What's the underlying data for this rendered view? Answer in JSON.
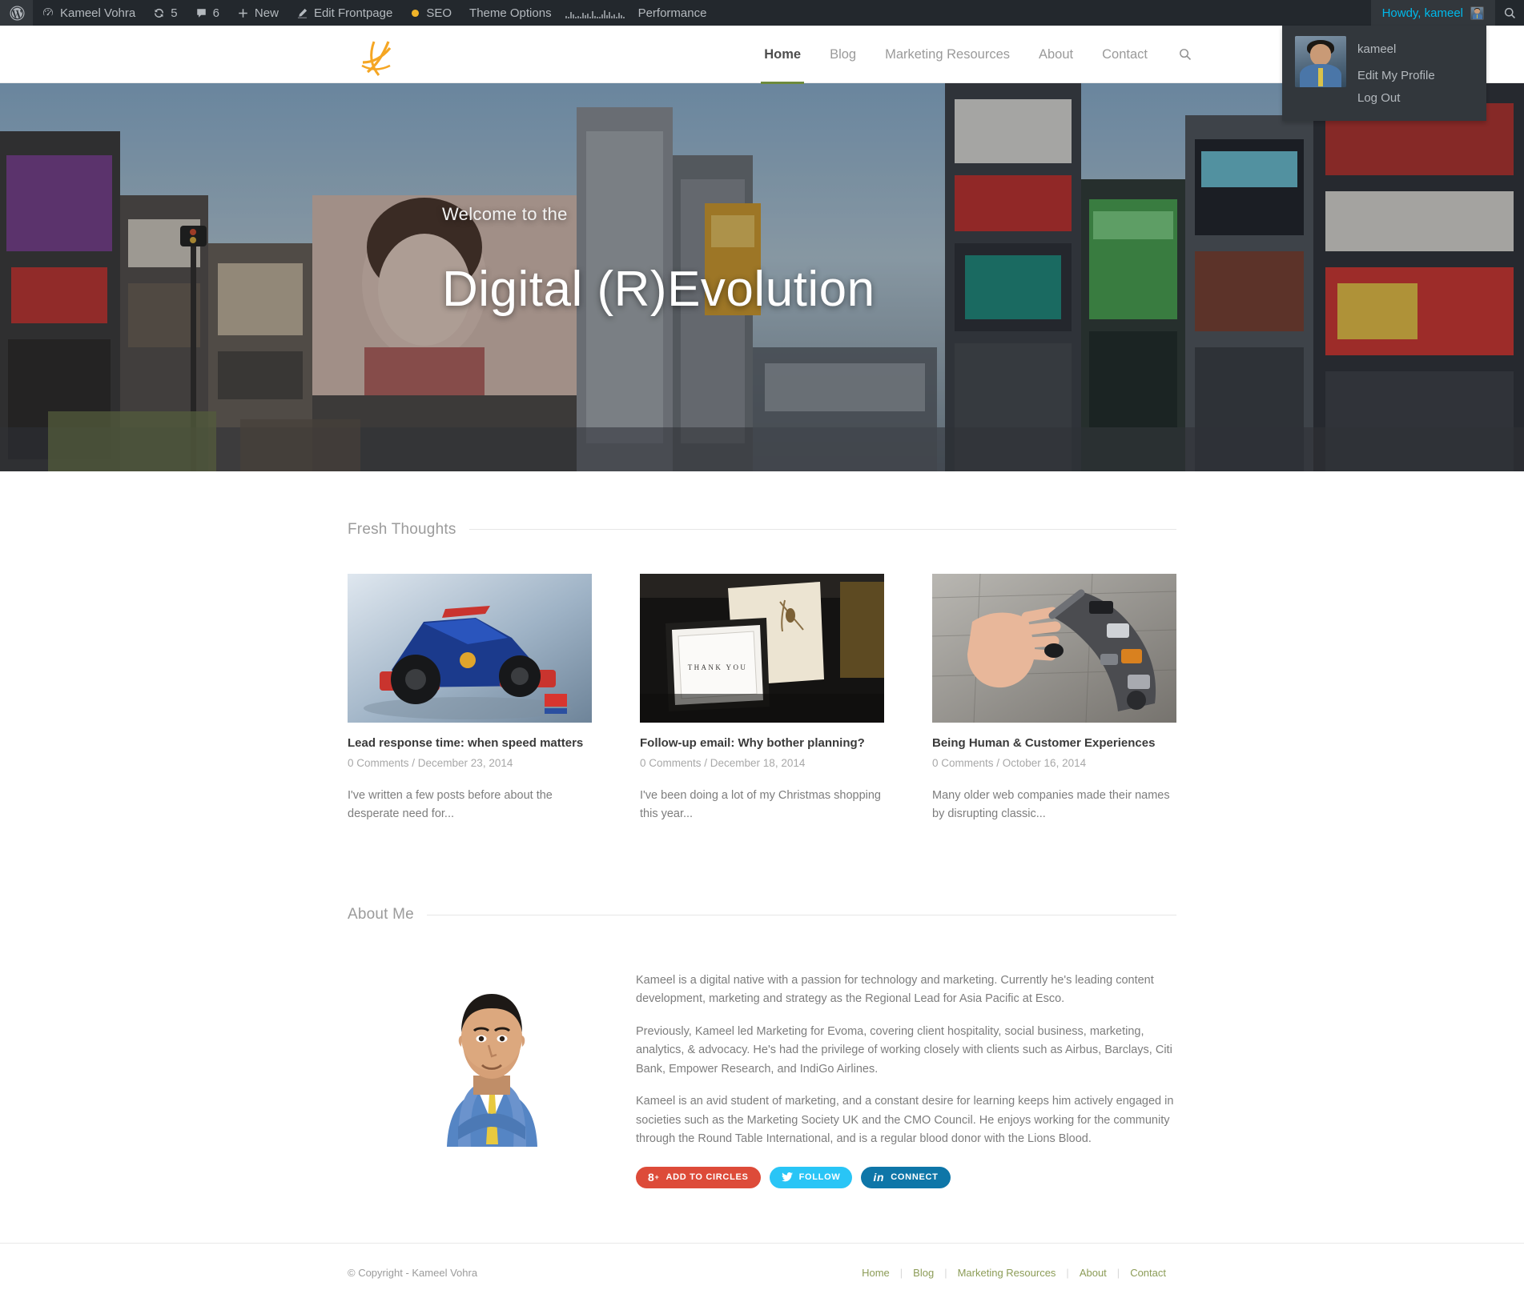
{
  "adminbar": {
    "wp_logo": "wordpress-icon",
    "site_name": "Kameel Vohra",
    "updates_count": "5",
    "comments_count": "6",
    "new_label": "New",
    "edit_frontpage_label": "Edit Frontpage",
    "seo_label": "SEO",
    "theme_options_label": "Theme Options",
    "performance_label": "Performance",
    "howdy_label": "Howdy, kameel",
    "dropdown": {
      "username": "kameel",
      "edit_profile": "Edit My Profile",
      "logout": "Log Out"
    }
  },
  "header": {
    "logo_alt": "site-logo",
    "nav": [
      {
        "label": "Home",
        "active": true
      },
      {
        "label": "Blog",
        "active": false
      },
      {
        "label": "Marketing Resources",
        "active": false
      },
      {
        "label": "About",
        "active": false
      },
      {
        "label": "Contact",
        "active": false
      }
    ],
    "search_icon": "search-icon"
  },
  "hero": {
    "subtitle": "Welcome to the",
    "title": "Digital (R)Evolution"
  },
  "fresh_thoughts": {
    "section_title": "Fresh Thoughts",
    "posts": [
      {
        "title": "Lead response time: when speed matters",
        "comments": "0 Comments",
        "separator": "/",
        "date": "December 23, 2014",
        "meta": "0 Comments / December 23, 2014",
        "excerpt": "I've written a few posts before about the desperate need for...",
        "thumb": "formula-one-race-car-photo"
      },
      {
        "title": "Follow-up email: Why bother planning?",
        "comments": "0 Comments",
        "separator": "/",
        "date": "December 18, 2014",
        "meta": "0 Comments / December 18, 2014",
        "excerpt": "I've been doing a lot of my Christmas shopping this year...",
        "thumb": "thank-you-card-photo"
      },
      {
        "title": "Being Human & Customer Experiences",
        "comments": "0 Comments",
        "separator": "/",
        "date": "October 16, 2014",
        "meta": "0 Comments / October 16, 2014",
        "excerpt": "Many older web companies made their names by disrupting classic...",
        "thumb": "human-hand-touching-robot-hand-photo"
      }
    ]
  },
  "about": {
    "section_title": "About Me",
    "photo_alt": "kameel-vohra-portrait",
    "paragraphs": [
      "Kameel is a digital native with a passion for technology and marketing. Currently he's leading content development, marketing and strategy as the Regional Lead for Asia Pacific at Esco.",
      "Previously, Kameel led Marketing for Evoma, covering client hospitality, social business, marketing, analytics, & advocacy. He's had the privilege of working closely with clients such as Airbus, Barclays, Citi Bank, Empower Research, and IndiGo Airlines.",
      "Kameel is an avid student of marketing, and a constant desire for learning keeps him actively engaged in societies such as the Marketing Society UK and the CMO Council. He enjoys working for the community through the Round Table International, and is a regular blood donor with the Lions Blood."
    ],
    "social": [
      {
        "label": "ADD TO CIRCLES",
        "network": "google-plus",
        "color": "#dd4b39"
      },
      {
        "label": "FOLLOW",
        "network": "twitter",
        "color": "#29c5f6"
      },
      {
        "label": "CONNECT",
        "network": "linkedin",
        "color": "#0e76a8"
      }
    ]
  },
  "footer": {
    "copyright": "© Copyright - Kameel Vohra",
    "nav": [
      {
        "label": "Home"
      },
      {
        "label": "Blog"
      },
      {
        "label": "Marketing Resources"
      },
      {
        "label": "About"
      },
      {
        "label": "Contact"
      }
    ],
    "separator": "|"
  },
  "colors": {
    "adminbar_bg": "#23282d",
    "adminbar_hover": "#32373c",
    "adminbar_link": "#00b9eb",
    "accent_green": "#6d8b3c",
    "footer_link": "#8c9c57",
    "logo_red": "#ed1c16"
  }
}
